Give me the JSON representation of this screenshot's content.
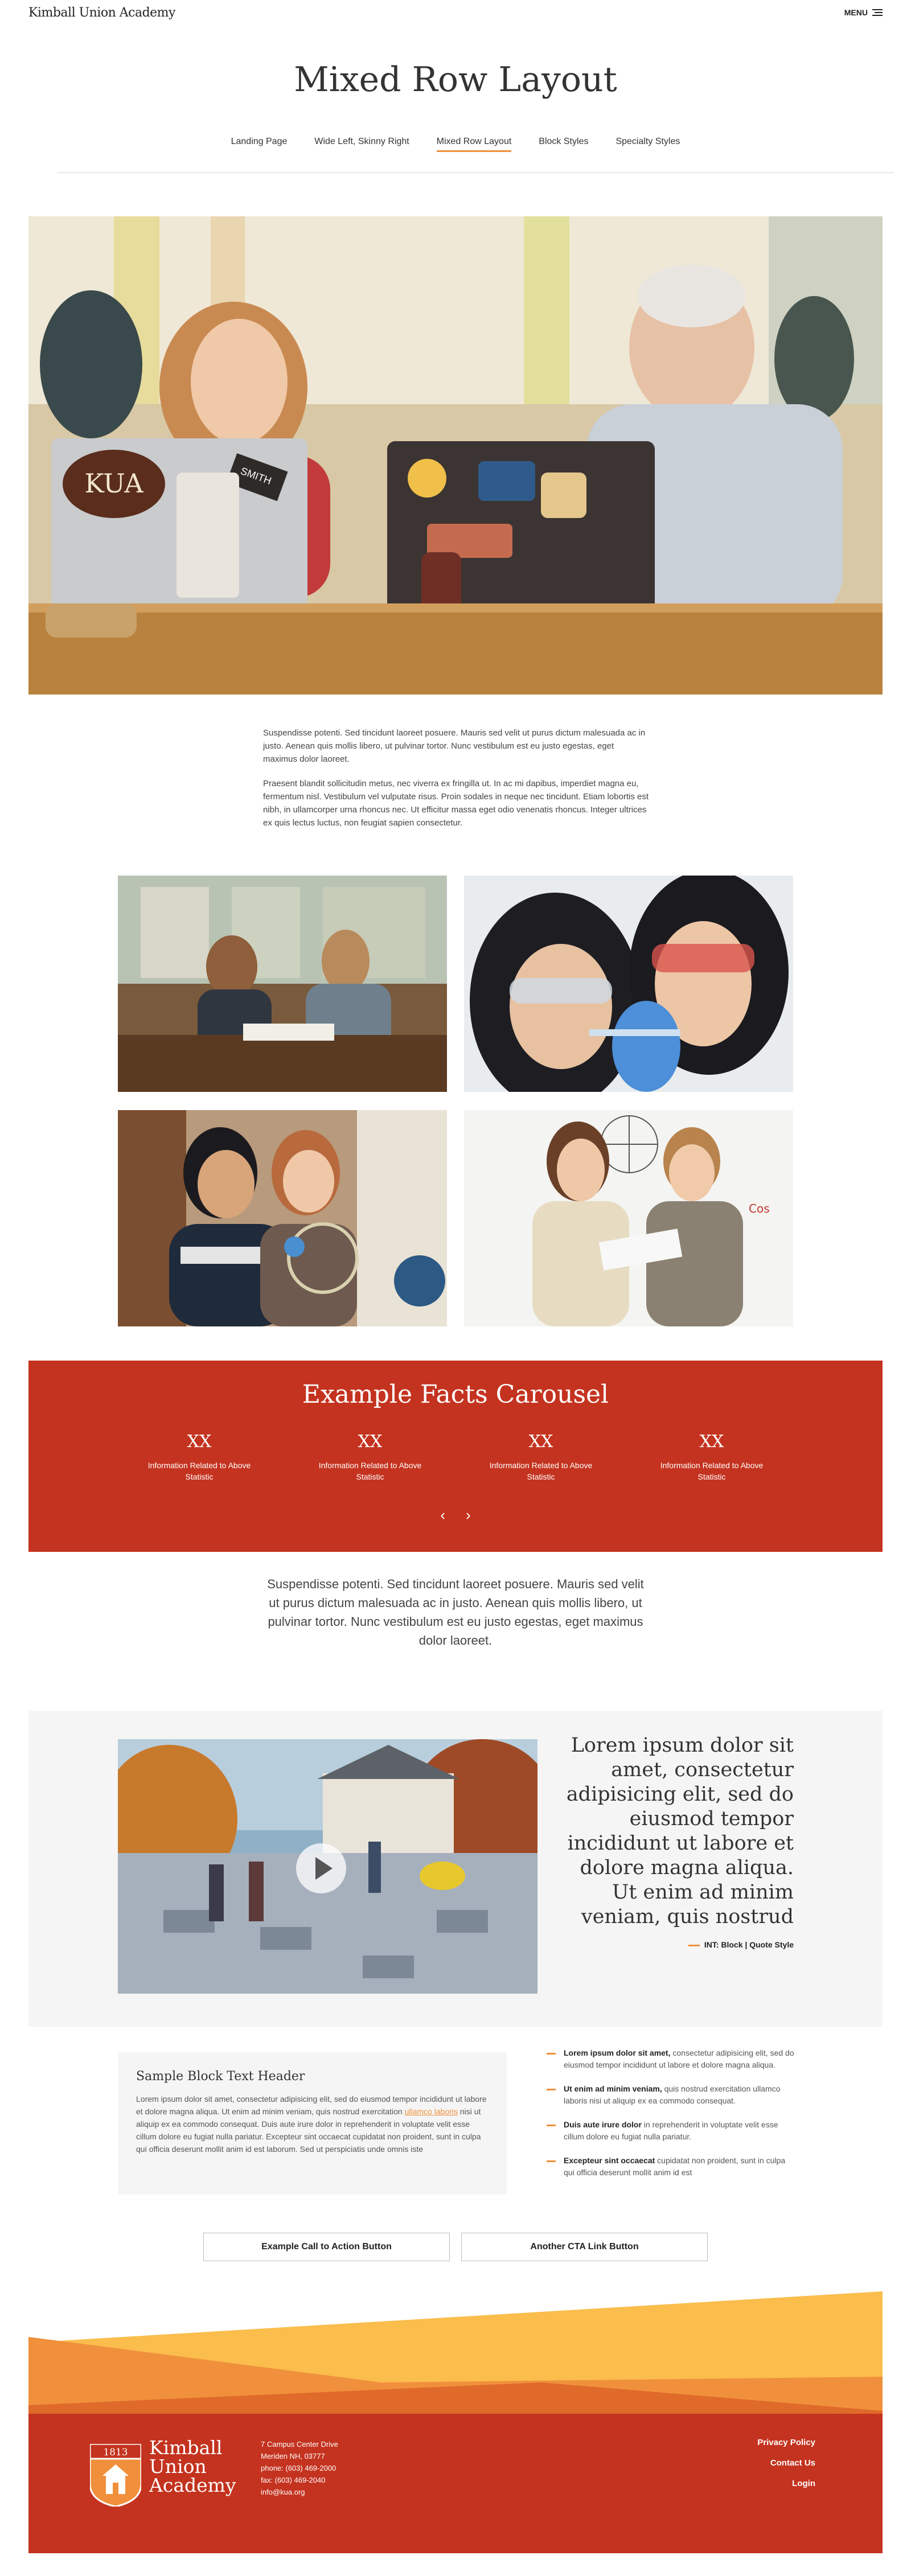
{
  "header": {
    "logo_text": "Kimball Union Academy",
    "menu_label": "MENU"
  },
  "page_title": "Mixed Row Layout",
  "subnav": [
    {
      "label": "Landing Page"
    },
    {
      "label": "Wide Left, Skinny Right"
    },
    {
      "label": "Mixed Row Layout",
      "active": true
    },
    {
      "label": "Block Styles"
    },
    {
      "label": "Specialty Styles"
    }
  ],
  "hero": {
    "laptop_sticker_left": "KUA",
    "laptop_sticker_small": "SMITH"
  },
  "intro": {
    "p1": "Suspendisse potenti. Sed tincidunt laoreet posuere. Mauris sed velit ut purus dictum malesuada ac in justo. Aenean quis mollis libero, ut pulvinar tortor. Nunc vestibulum est eu justo egestas, eget maximus dolor laoreet.",
    "p2": "Praesent blandit sollicitudin metus, nec viverra ex fringilla ut. In ac mi dapibus, imperdiet magna eu, fermentum nisl. Vestibulum vel vulputate risus. Proin sodales in neque nec tincidunt. Etiam lobortis est nibh, in ullamcorper urna rhoncus nec. Ut efficitur massa eget odio venenatis rhoncus. Integer ultrices ex quis lectus luctus, non feugiat sapien consectetur."
  },
  "facts": {
    "title": "Example Facts Carousel",
    "items": [
      {
        "value": "XX",
        "label": "Information Related to Above Statistic"
      },
      {
        "value": "XX",
        "label": "Information Related to Above Statistic"
      },
      {
        "value": "XX",
        "label": "Information Related to Above Statistic"
      },
      {
        "value": "XX",
        "label": "Information Related to Above Statistic"
      }
    ],
    "prev": "‹",
    "next": "›"
  },
  "lead_text": "Suspendisse potenti. Sed tincidunt laoreet posuere. Mauris sed velit ut purus dictum malesuada ac in justo. Aenean quis mollis libero, ut pulvinar tortor. Nunc vestibulum est eu justo egestas, eget maximus dolor laoreet.",
  "quote": {
    "text": "Lorem ipsum dolor sit amet, consectetur adipisicing elit, sed do eiusmod tempor incididunt ut labore et dolore magna aliqua. Ut enim ad minim veniam, quis nostrud",
    "cite": "INT: Block | Quote Style"
  },
  "sample_block": {
    "title": "Sample Block Text Header",
    "before_link": "Lorem ipsum dolor sit amet, consectetur adipisicing elit, sed do eiusmod tempor incididunt ut labore et dolore magna aliqua. Ut enim ad minim veniam, quis nostrud exercitation ",
    "link": "ullamco laboris",
    "after_link": " nisi ut aliquip ex ea commodo consequat. Duis aute irure dolor in reprehenderit in voluptate velit esse cillum dolore eu fugiat nulla pariatur. Excepteur sint occaecat cupidatat non proident, sunt in culpa qui officia deserunt mollit anim id est laborum. Sed ut perspiciatis unde omnis iste"
  },
  "bullets": [
    {
      "bold": "Lorem ipsum dolor sit amet,",
      "text": " consectetur adipisicing elit, sed do eiusmod tempor incididunt ut labore et dolore magna aliqua."
    },
    {
      "bold": "Ut enim ad minim veniam,",
      "text": " quis nostrud exercitation ullamco laboris nisi ut aliquip ex ea commodo consequat."
    },
    {
      "bold": "Duis aute irure dolor",
      "text": " in reprehenderit in voluptate velit esse cillum dolore eu fugiat nulla pariatur."
    },
    {
      "bold": "Excepteur sint occaecat",
      "text": " cupidatat non proident, sunt in culpa qui officia deserunt mollit anim id est"
    }
  ],
  "cta": {
    "primary": "Example Call to Action Button",
    "secondary": "Another CTA Link Button"
  },
  "footer": {
    "crest_year": "1813",
    "name_line1": "Kimball",
    "name_line2": "Union",
    "name_line3": "Academy",
    "address": [
      "7 Campus Center Drive",
      "Meriden NH, 03777",
      "phone: (603) 469-2000",
      "fax: (603) 469-2040",
      "info@kua.org"
    ],
    "links": [
      "Privacy Policy",
      "Contact Us",
      "Login"
    ]
  },
  "colors": {
    "accent_orange": "#f0903c",
    "brand_red": "#c4331f",
    "footer_yellow": "#fbbd4c"
  }
}
